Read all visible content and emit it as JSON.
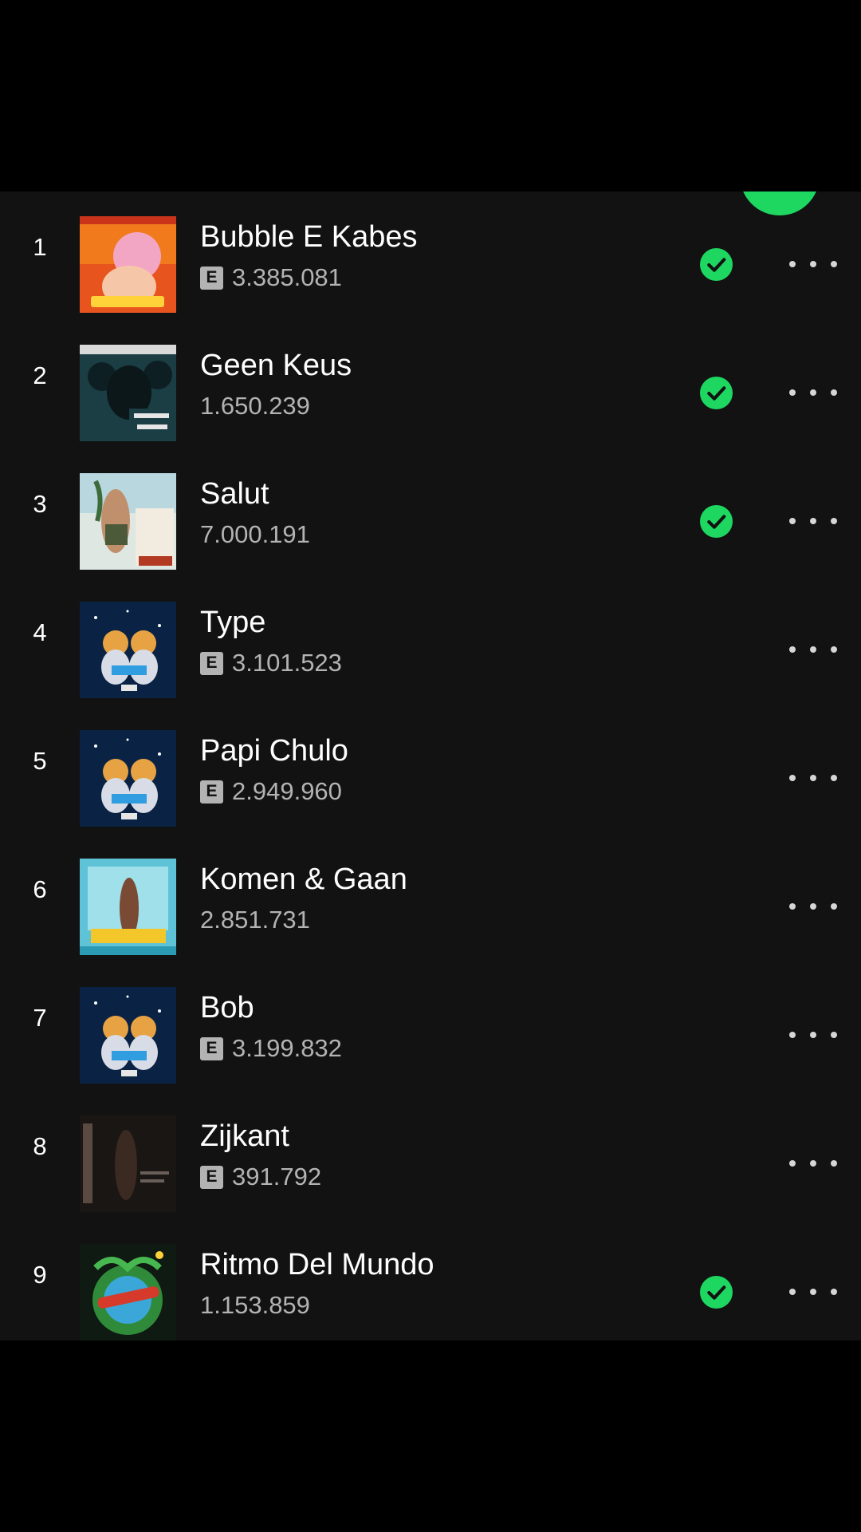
{
  "colors": {
    "background": "#121212",
    "accent": "#1ed760",
    "text_primary": "#ffffff",
    "text_secondary": "#b3b3b3"
  },
  "icons": {
    "saved": "check-circle-icon",
    "more": "more-horizontal-icon",
    "explicit": "explicit-badge-icon"
  },
  "tracks": [
    {
      "rank": "1",
      "title": "Bubble E Kabes",
      "explicit": true,
      "explicit_label": "E",
      "plays": "3.385.081",
      "saved": true
    },
    {
      "rank": "2",
      "title": "Geen Keus",
      "explicit": false,
      "plays": "1.650.239",
      "saved": true
    },
    {
      "rank": "3",
      "title": "Salut",
      "explicit": false,
      "plays": "7.000.191",
      "saved": true
    },
    {
      "rank": "4",
      "title": "Type",
      "explicit": true,
      "explicit_label": "E",
      "plays": "3.101.523",
      "saved": false
    },
    {
      "rank": "5",
      "title": "Papi Chulo",
      "explicit": true,
      "explicit_label": "E",
      "plays": "2.949.960",
      "saved": false
    },
    {
      "rank": "6",
      "title": "Komen & Gaan",
      "explicit": false,
      "plays": "2.851.731",
      "saved": false
    },
    {
      "rank": "7",
      "title": "Bob",
      "explicit": true,
      "explicit_label": "E",
      "plays": "3.199.832",
      "saved": false
    },
    {
      "rank": "8",
      "title": "Zijkant",
      "explicit": true,
      "explicit_label": "E",
      "plays": "391.792",
      "saved": false
    },
    {
      "rank": "9",
      "title": "Ritmo Del Mundo",
      "explicit": false,
      "plays": "1.153.859",
      "saved": true
    }
  ]
}
